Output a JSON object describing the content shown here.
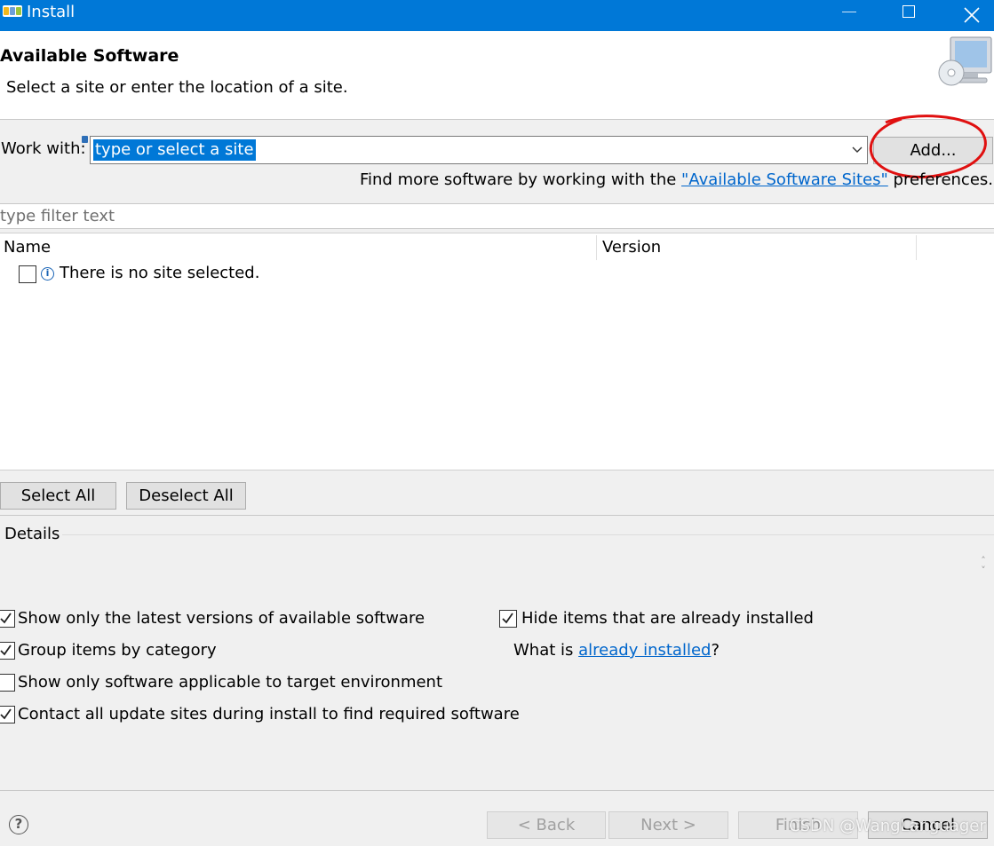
{
  "window": {
    "title": "Install"
  },
  "header": {
    "heading": "Available Software",
    "subtitle": "Select a site or enter the location of a site."
  },
  "work_with": {
    "label": "Work with:",
    "value": "type or select a site",
    "add_button": "Add...",
    "find_more_prefix": "Find more software by working with the ",
    "find_more_link": "\"Available Software Sites\"",
    "find_more_suffix": " preferences."
  },
  "filter": {
    "placeholder": "type filter text"
  },
  "tree": {
    "columns": [
      "Name",
      "Version"
    ],
    "rows": [
      {
        "label": "There is no site selected.",
        "checked": false
      }
    ]
  },
  "selection_buttons": {
    "select_all": "Select All",
    "deselect_all": "Deselect All"
  },
  "details": {
    "label": "Details"
  },
  "options": {
    "latest_versions": {
      "label": "Show only the latest versions of available software",
      "checked": true
    },
    "group_by_category": {
      "label": "Group items by category",
      "checked": true
    },
    "target_environment": {
      "label": "Show only software applicable to target environment",
      "checked": false
    },
    "contact_sites": {
      "label": "Contact all update sites during install to find required software",
      "checked": true
    },
    "hide_installed": {
      "label": "Hide items that are already installed",
      "checked": true
    },
    "what_is_prefix": "What is ",
    "what_is_link": "already installed",
    "what_is_suffix": "?"
  },
  "footer": {
    "back": "< Back",
    "next": "Next >",
    "finish": "Finish",
    "cancel": "Cancel",
    "watermark": "CSDN @WangLanguager"
  },
  "colors": {
    "titlebar": "#0078d7",
    "link": "#0066cc",
    "annotation": "#e01010"
  }
}
